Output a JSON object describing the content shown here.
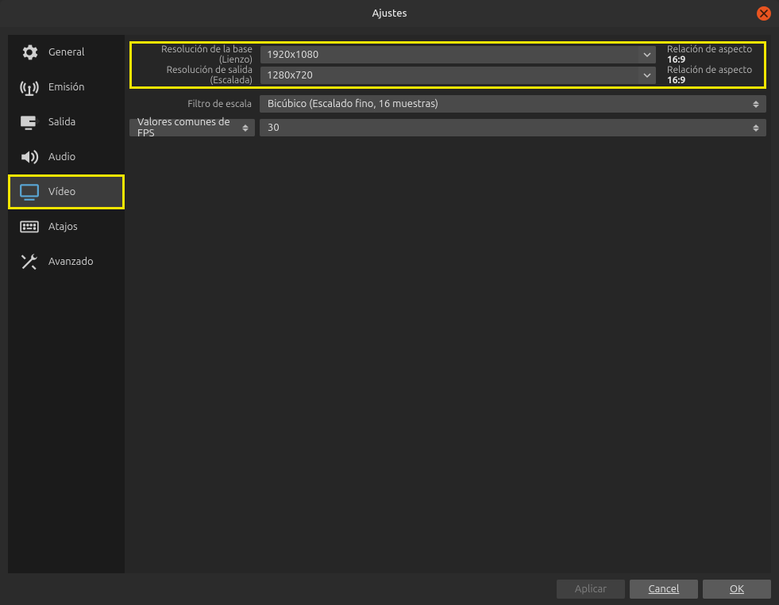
{
  "window": {
    "title": "Ajustes"
  },
  "sidebar": {
    "items": [
      {
        "label": "General"
      },
      {
        "label": "Emisión"
      },
      {
        "label": "Salida"
      },
      {
        "label": "Audio"
      },
      {
        "label": "Vídeo"
      },
      {
        "label": "Atajos"
      },
      {
        "label": "Avanzado"
      }
    ],
    "active_index": 4,
    "highlight_index": 4
  },
  "form": {
    "base_res_label": "Resolución de la base (Lienzo)",
    "base_res_value": "1920x1080",
    "base_aspect_prefix": "Relación de aspecto ",
    "base_aspect_ratio": "16:9",
    "out_res_label": "Resolución de salida (Escalada)",
    "out_res_value": "1280x720",
    "out_aspect_prefix": "Relación de aspecto ",
    "out_aspect_ratio": "16:9",
    "scale_filter_label": "Filtro de escala",
    "scale_filter_value": "Bicúbico (Escalado fino, 16 muestras)",
    "fps_mode_label": "Valores comunes de FPS",
    "fps_value": "30"
  },
  "footer": {
    "apply": "Aplicar",
    "cancel": "Cancel",
    "ok": "OK"
  },
  "highlight_color": "#f5e600"
}
